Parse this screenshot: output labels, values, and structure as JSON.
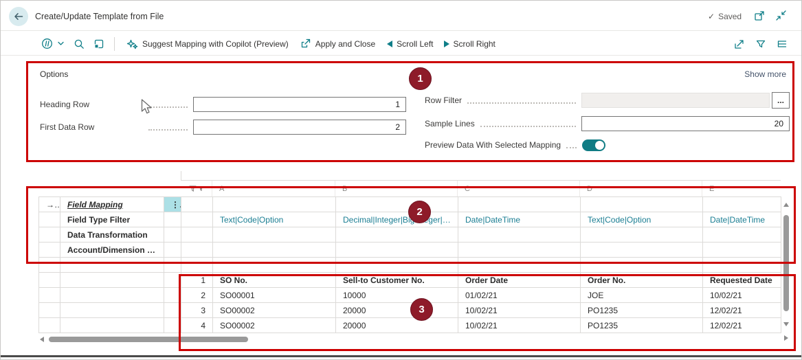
{
  "header": {
    "title": "Create/Update Template from File",
    "saved": "Saved"
  },
  "toolbar": {
    "suggest_mapping": "Suggest Mapping with Copilot (Preview)",
    "apply_and_close": "Apply and Close",
    "scroll_left": "Scroll Left",
    "scroll_right": "Scroll Right"
  },
  "options": {
    "title": "Options",
    "show_more": "Show more",
    "heading_row_label": "Heading Row",
    "heading_row_value": "1",
    "first_data_row_label": "First Data Row",
    "first_data_row_value": "2",
    "row_filter_label": "Row Filter",
    "row_filter_value": "",
    "sample_lines_label": "Sample Lines",
    "sample_lines_value": "20",
    "preview_label": "Preview Data With Selected Mapping",
    "preview_state": "on"
  },
  "grid": {
    "columns": [
      "A",
      "B",
      "C",
      "D",
      "E"
    ],
    "rows": {
      "field_mapping": {
        "label": "Field Mapping"
      },
      "field_type_filter": {
        "label": "Field Type Filter",
        "values": [
          "Text|Code|Option",
          "Decimal|Integer|BigInteger|Option",
          "Date|DateTime",
          "Text|Code|Option",
          "Date|DateTime"
        ]
      },
      "data_transformation": {
        "label": "Data Transformation"
      },
      "account_dimension_mapping": {
        "label": "Account/Dimension Mapping"
      }
    },
    "preview": {
      "row_numbers": [
        "1",
        "2",
        "3",
        "4"
      ],
      "header": [
        "SO No.",
        "Sell-to Customer No.",
        "Order Date",
        "Order No.",
        "Requested Date"
      ],
      "rows": [
        [
          "SO00001",
          "10000",
          "01/02/21",
          "JOE",
          "10/02/21"
        ],
        [
          "SO00002",
          "20000",
          "10/02/21",
          "PO1235",
          "12/02/21"
        ],
        [
          "SO00002",
          "20000",
          "10/02/21",
          "PO1235",
          "12/02/21"
        ]
      ]
    }
  },
  "annotations": {
    "badge_1": "1",
    "badge_2": "2",
    "badge_3": "3"
  },
  "icons": {
    "check": "✓",
    "chevron_down": "⌄",
    "ellipsis_menu": "⋮",
    "assist_edit": "...",
    "row_marker": "→"
  },
  "colors": {
    "accent_teal": "#0f7e88",
    "link_teal": "#1b7e93",
    "annotation_red": "#cc0000",
    "badge_red": "#8e1b29",
    "field_mapping_red": "#c00000",
    "toggle_on": "#107c84"
  }
}
